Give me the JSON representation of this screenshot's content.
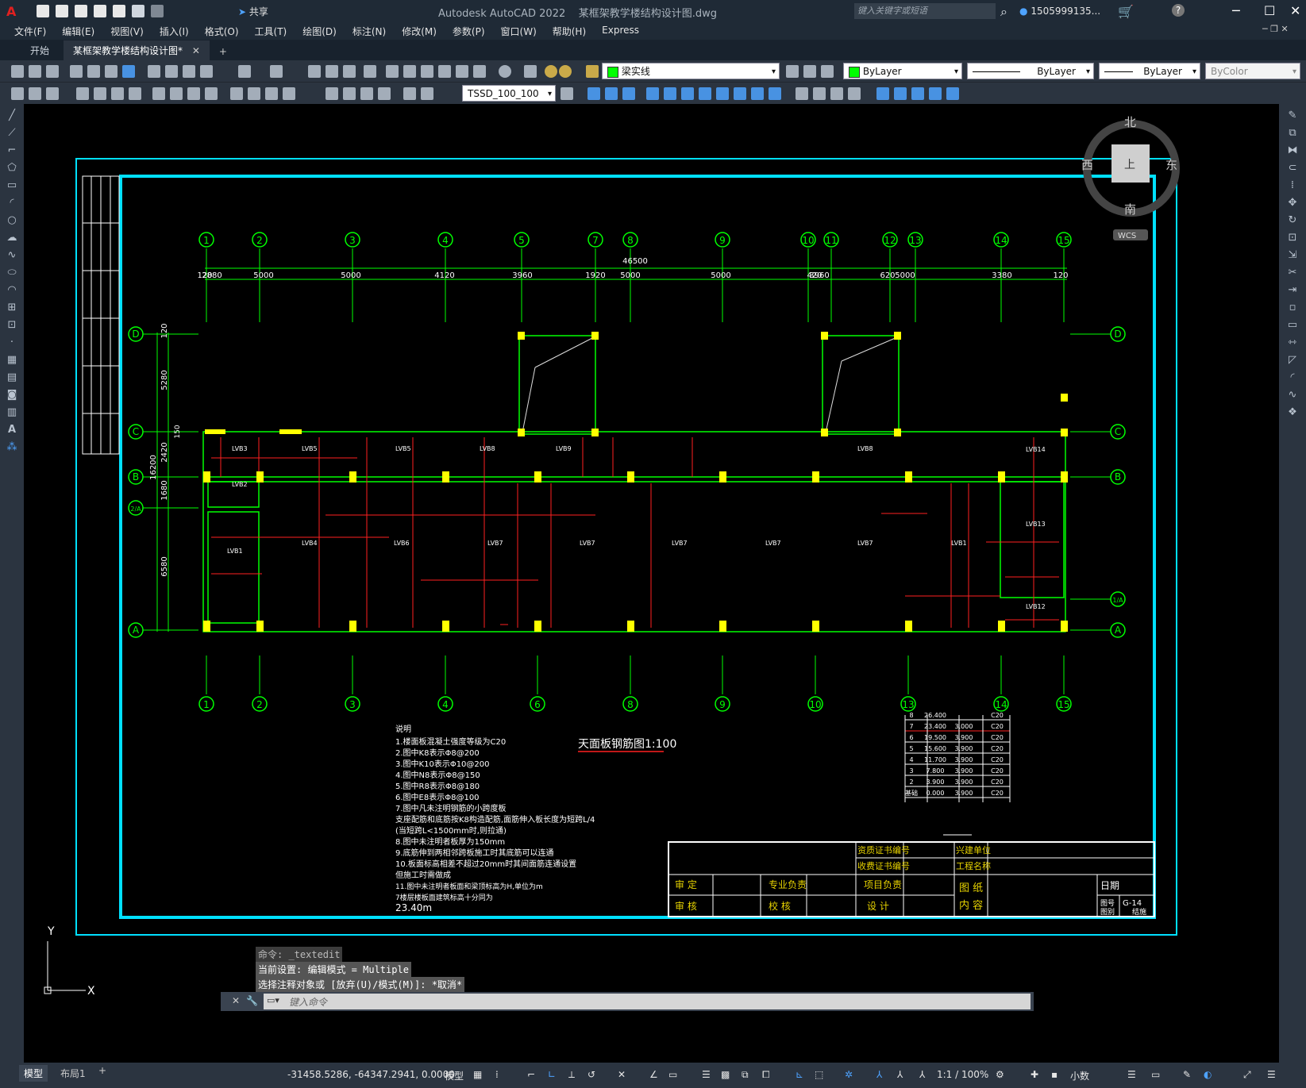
{
  "title": {
    "app_title": "Autodesk AutoCAD 2022",
    "file_name": "某框架教学楼结构设计图.dwg",
    "share_label": "共享",
    "search_placeholder": "键入关键字或短语",
    "user_name": "1505999135..."
  },
  "menus": [
    "文件(F)",
    "编辑(E)",
    "视图(V)",
    "插入(I)",
    "格式(O)",
    "工具(T)",
    "绘图(D)",
    "标注(N)",
    "修改(M)",
    "参数(P)",
    "窗口(W)",
    "帮助(H)",
    "Express"
  ],
  "tabs": {
    "start": "开始",
    "active": "某框架教学楼结构设计图*",
    "add": "+"
  },
  "toolbar": {
    "layer": "梁实线",
    "color": "ByLayer",
    "linetype": "ByLayer",
    "lineweight": "ByLayer",
    "plotstyle": "ByColor",
    "dimstyle": "TSSD_100_100"
  },
  "viewcube": {
    "north": "北",
    "south": "南",
    "east": "东",
    "west": "西",
    "top": "上",
    "wcs": "WCS"
  },
  "drawing": {
    "grid_top": [
      "1",
      "2",
      "3",
      "4",
      "5",
      "7",
      "8",
      "9",
      "10",
      "11",
      "12",
      "13",
      "14",
      "15"
    ],
    "grid_bottom": [
      "1",
      "2",
      "3",
      "4",
      "6",
      "8",
      "9",
      "10",
      "13",
      "14",
      "15"
    ],
    "grid_left": [
      "D",
      "C",
      "B",
      "2/A",
      "A"
    ],
    "grid_right": [
      "D",
      "C",
      "B",
      "1/A",
      "A"
    ],
    "total_dim": "46500",
    "dims_top": [
      "120",
      "2880",
      "5000",
      "5000",
      "4120",
      "3960",
      "1920",
      "5000",
      "5000",
      "420",
      "3960",
      "620",
      "5000",
      "3380",
      "120"
    ],
    "dims_left": [
      "120",
      "5280",
      "2420",
      "1680",
      "6580"
    ],
    "dim_total_left": "16200",
    "dim_small_left": "150",
    "slabs": [
      "LVB3",
      "LVB5",
      "LVB5",
      "LVB8",
      "LVB9",
      "LVB2",
      "LVB1",
      "LVB4",
      "LVB6",
      "LVB7",
      "LVB7",
      "LVB7",
      "LVB7",
      "LVB7",
      "LVB1",
      "LVB13",
      "LVB12",
      "LVB14",
      "LVB8"
    ],
    "drawing_title": "天面板钢筋图1:100",
    "notes_title": "说明",
    "notes": [
      "1.楼面板混凝土强度等级为C20",
      "2.图中K8表示Φ8@200",
      "3.图中K10表示Φ10@200",
      "4.图中N8表示Φ8@150",
      "5.图中R8表示Φ8@180",
      "6.图中E8表示Φ8@100",
      "7.图中凡未注明钢筋的小跨度板",
      "  支座配筋和底筋按K8构造配筋,面筋伸入板长度为短跨L/4",
      "  (当短跨L<1500mm时,则拉通)",
      "8.图中未注明者板厚为150mm",
      "9.底筋伸到两相邻跨板施工时其底筋可以连通",
      "10.板面标高相差不超过20mm时其间面筋连通设置",
      "   但施工时需做成",
      "11.图中未注明者板面和梁顶标高为H,单位为m",
      "   7楼层楼板面建筑标高十分同为",
      "   23.40m"
    ],
    "level_table": [
      [
        "8",
        "26.400",
        "",
        "C20"
      ],
      [
        "7",
        "23.400",
        "3.000",
        "C20"
      ],
      [
        "6",
        "19.500",
        "3.900",
        "C20"
      ],
      [
        "5",
        "15.600",
        "3.900",
        "C20"
      ],
      [
        "4",
        "11.700",
        "3.900",
        "C20"
      ],
      [
        "3",
        "7.800",
        "3.900",
        "C20"
      ],
      [
        "2",
        "3.900",
        "3.900",
        "C20"
      ],
      [
        "基础",
        "0.000",
        "3.900",
        "C20"
      ]
    ],
    "title_block": {
      "qual_cert": "资质证书编号",
      "fee_cert": "收费证书编号",
      "client": "兴建单位",
      "project": "工程名称",
      "approve": "审  定",
      "check": "审  核",
      "prof_lead": "专业负责",
      "proofread": "校  核",
      "proj_lead": "项目负责",
      "design": "设  计",
      "drawing_content": "图  纸",
      "content": "内  容",
      "date": "日期",
      "drawing_no": "图号",
      "no_value": "G-14",
      "drawing_type": "图别",
      "type_value": "结施"
    }
  },
  "command": {
    "line1": "命令: _textedit",
    "line2": "当前设置: 编辑模式 = Multiple",
    "line3": "选择注释对象或 [放弃(U)/模式(M)]: *取消*",
    "placeholder": "键入命令"
  },
  "ucs": {
    "y": "Y",
    "x": "X"
  },
  "status": {
    "model_tab": "模型",
    "layout_tab": "布局1",
    "add": "+",
    "coords": "-31458.5286, -64347.2941, 0.0000",
    "space": "模型",
    "scale": "1:1 / 100%",
    "units": "小数"
  },
  "colors": {
    "frame": "#00e0ff",
    "axis": "#00ff00",
    "grid_bubble": "#00ff00",
    "rebar": "#ff2020",
    "column": "#ffff00",
    "text": "#ffffff"
  }
}
